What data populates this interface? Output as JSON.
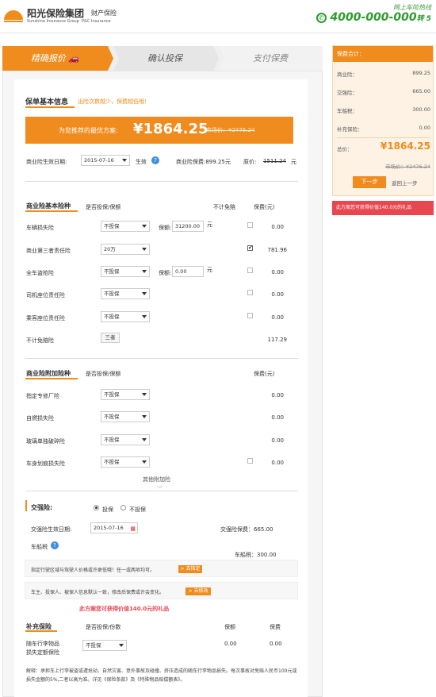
{
  "header": {
    "brand_cn": "阳光保险集团",
    "brand_en": "Sunshine Insurance Group",
    "sub_cn": "财产保险",
    "sub_en": "P&C Insurance",
    "hotline_label": "网上车险热线",
    "hotline_number": "4000-000-000",
    "hotline_suffix": "转 5"
  },
  "steps": [
    "精确报价",
    "确认投保",
    "支付保费"
  ],
  "basic": {
    "title": "保单基本信息",
    "tip": "出险次数越少，保费越低哦！",
    "rec_label": "为您推荐的最优方案:",
    "rec_price": "¥1864.25",
    "market_label": "市场价：¥2476.24",
    "date_label": "商业险生效日期:",
    "date_value": "2015-07-16",
    "effect": "生效",
    "premium_label": "商业险保费:899.25元",
    "orig_label": "原价:",
    "orig_value": "1511.24",
    "orig_unit": "元"
  },
  "commercial": {
    "title": "商业险基本险种",
    "col_cover": "是否投保/保额",
    "col_deduct": "不计免赔",
    "col_fee": "保费(元)",
    "rows": [
      {
        "name": "车辆损失险",
        "sel": "不投保",
        "amount_label": "保额:",
        "amount": "31200.00",
        "unit": "元",
        "fee": "0.00"
      },
      {
        "name": "商业第三者责任险",
        "sel": "20万",
        "fee": "781.96"
      },
      {
        "name": "全车盗抢险",
        "sel": "不投保",
        "amount_label": "保额:",
        "amount": "0.00",
        "unit": "元",
        "fee": "0.00"
      },
      {
        "name": "司机座位责任险",
        "sel": "不投保",
        "fee": "0.00"
      },
      {
        "name": "乘客座位责任险",
        "sel": "不投保",
        "fee": "0.00"
      },
      {
        "name": "不计免赔险",
        "btn": "三者",
        "fee": "117.29"
      }
    ]
  },
  "additional": {
    "title": "商业险附加险种",
    "col_cover": "是否投保/保额",
    "col_fee": "保费(元)",
    "rows": [
      {
        "name": "指定专修厂险",
        "sel": "不投保",
        "fee": "0.00"
      },
      {
        "name": "自燃损失险",
        "sel": "不投保",
        "fee": "0.00"
      },
      {
        "name": "玻璃单独破碎险",
        "sel": "不投保",
        "fee": "0.00"
      },
      {
        "name": "车身划痕损失险",
        "sel": "不投保",
        "fee": "0.00"
      }
    ],
    "more": "其他附加险"
  },
  "compulsory": {
    "title": "交强险:",
    "opt_yes": "投保",
    "opt_no": "不投保",
    "date_label": "交强险生效日期:",
    "date_value": "2015-07-16",
    "premium_label": "交强险保费：",
    "premium_value": "665.00",
    "tax_label": "车船税",
    "tax_text": "车船税：300.00"
  },
  "notices": [
    {
      "text": "指定行驶区域与驾驶人价格或许更低哦！任一或两项均可。",
      "btn": "> 去指定"
    },
    {
      "text": "车主、投保人、被保人信息默认一致，修改后保费或许会变化。",
      "btn": "> 去修改"
    }
  ],
  "gift": "此方案您可获得价值140.0元的礼品",
  "supplement": {
    "title": "补充保险",
    "col_cover": "是否投保/份数",
    "col_amount": "保额",
    "col_fee": "保费",
    "row": {
      "name1": "随车行李物品",
      "name2": "损失定额保险",
      "sel": "不投保",
      "amount": "0.00",
      "fee": "0.00"
    },
    "note": "解释：承担车上行李被盗或遭抢劫，自然灾害、意外事故及碰撞、挤压造成的随车行李物品损失。每次事故对免赔人民币100元或损失金额的5%,二者以高为准。详见《保险条款》及《特殊物品赔偿额表》。"
  },
  "summary": {
    "title": "保费合计：",
    "rows": [
      {
        "label": "商业险：",
        "value": "899.25"
      },
      {
        "label": "交强险：",
        "value": "665.00"
      },
      {
        "label": "车船税：",
        "value": "300.00"
      },
      {
        "label": "补充保险：",
        "value": "0.00"
      }
    ],
    "total_label": "总价：",
    "total": "¥1864.25",
    "market": "市场价：¥2476.24",
    "next": "下一步",
    "back": "返回上一步",
    "gift": "此方案您可获得价值140.0元的礼品"
  },
  "colors": {
    "accent": "#f08c1e",
    "red": "#e8474f",
    "green": "#2e9b2e"
  }
}
